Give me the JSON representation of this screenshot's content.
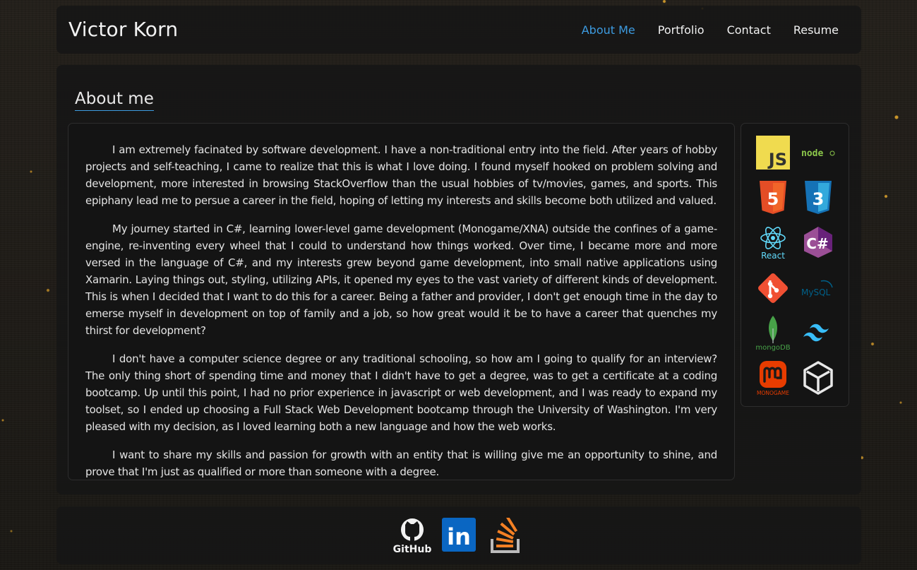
{
  "header": {
    "brand": "Victor Korn",
    "nav": [
      {
        "label": "About Me",
        "active": true
      },
      {
        "label": "Portfolio",
        "active": false
      },
      {
        "label": "Contact",
        "active": false
      },
      {
        "label": "Resume",
        "active": false
      }
    ]
  },
  "about": {
    "heading": "About me",
    "paragraphs": [
      "I am extremely facinated by software development. I have a non-traditional entry into the field. After years of hobby projects and self-teaching, I came to realize that this is what I love doing. I found myself hooked on problem solving and development, more interested in browsing StackOverflow than the usual hobbies of tv/movies, games, and sports. This epiphany lead me to persue a career in the field, hoping of letting my interests and skills become both utilized and valued.",
      "My journey started in C#, learning lower-level game development (Monogame/XNA) outside the confines of a game-engine, re-inventing every wheel that I could to understand how things worked. Over time, I became more and more versed in the language of C#, and my interests grew beyond game development, into small native applications using Xamarin. Laying things out, styling, utilizing APIs, it opened my eyes to the vast variety of different kinds of development. This is when I decided that I want to do this for a career. Being a father and provider, I don't get enough time in the day to emerse myself in development on top of family and a job, so how great would it be to have a career that quenches my thirst for development?",
      "I don't have a computer science degree or any traditional schooling, so how am I going to qualify for an interview? The only thing short of spending time and money that I didn't have to get a degree, was to get a certificate at a coding bootcamp. Up until this point, I had no prior experience in javascript or web development, and I was ready to expand my toolset, so I ended up choosing a Full Stack Web Development bootcamp through the University of Washington. I'm very pleased with my decision, as I loved learning both a new language and how the web works.",
      "I want to share my skills and passion for growth with an entity that is willing give me an opportunity to shine, and prove that I'm just as qualified or more than someone with a degree."
    ]
  },
  "skills": {
    "js": {
      "icon": "javascript-icon",
      "text": "JS"
    },
    "node": {
      "icon": "nodejs-icon",
      "text": "node"
    },
    "html5": {
      "icon": "html5-icon",
      "text": "5"
    },
    "css3": {
      "icon": "css3-icon",
      "text": "3"
    },
    "react": {
      "icon": "react-icon",
      "text": "React"
    },
    "csharp": {
      "icon": "csharp-icon",
      "text": "C#"
    },
    "git": {
      "icon": "git-icon"
    },
    "mysql": {
      "icon": "mysql-icon",
      "text": "MySQL"
    },
    "mongodb": {
      "icon": "mongodb-icon",
      "text": "mongoDB"
    },
    "tailwind": {
      "icon": "tailwind-icon"
    },
    "monogame": {
      "icon": "monogame-icon",
      "text": "MONOGAME"
    },
    "unity": {
      "icon": "unity-icon"
    }
  },
  "footer": {
    "github": {
      "icon": "github-icon",
      "text": "GitHub"
    },
    "linkedin": {
      "icon": "linkedin-icon",
      "text": "in"
    },
    "stackoverflow": {
      "icon": "stackoverflow-icon"
    }
  },
  "colors": {
    "accent": "#3d9be0",
    "panel": "#161616",
    "javascript": "#f0db4f",
    "node": "#8cc84b",
    "html5": "#e44d26",
    "css3": "#1572b6",
    "react": "#61dafb",
    "csharp": "#9b4f96",
    "git": "#f05033",
    "mysql": "#00618a",
    "mongodb": "#47a248",
    "tailwind": "#38bdf8",
    "monogame": "#e73c00",
    "linkedin": "#0a66c2",
    "stackoverflow": "#f48024"
  }
}
